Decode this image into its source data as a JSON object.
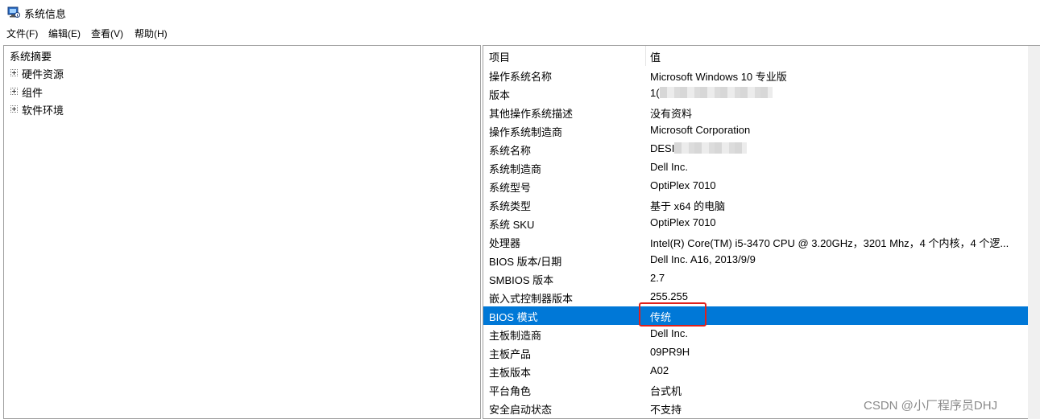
{
  "window": {
    "title": "系统信息",
    "icon": "system-information-icon"
  },
  "menu": [
    {
      "label": "文件(F)"
    },
    {
      "label": "编辑(E)"
    },
    {
      "label": "查看(V)"
    },
    {
      "label": "帮助(H)"
    }
  ],
  "tree": {
    "root": "系统摘要",
    "children": [
      {
        "label": "硬件资源"
      },
      {
        "label": "组件"
      },
      {
        "label": "软件环境"
      }
    ]
  },
  "table": {
    "headers": [
      "项目",
      "值"
    ],
    "rows": [
      {
        "k": "操作系统名称",
        "v": "Microsoft Windows 10 专业版"
      },
      {
        "k": "版本",
        "v": "1("
      },
      {
        "k": "其他操作系统描述",
        "v": "没有资料"
      },
      {
        "k": "操作系统制造商",
        "v": "Microsoft Corporation"
      },
      {
        "k": "系统名称",
        "v": "DESI"
      },
      {
        "k": "系统制造商",
        "v": "Dell Inc."
      },
      {
        "k": "系统型号",
        "v": "OptiPlex 7010"
      },
      {
        "k": "系统类型",
        "v": "基于 x64 的电脑"
      },
      {
        "k": "系统 SKU",
        "v": "OptiPlex 7010"
      },
      {
        "k": "处理器",
        "v": "Intel(R) Core(TM) i5-3470 CPU @ 3.20GHz，3201 Mhz，4 个内核，4 个逻..."
      },
      {
        "k": "BIOS 版本/日期",
        "v": "Dell Inc. A16, 2013/9/9"
      },
      {
        "k": "SMBIOS 版本",
        "v": "2.7"
      },
      {
        "k": "嵌入式控制器版本",
        "v": "255.255"
      },
      {
        "k": "BIOS 模式",
        "v": "传统"
      },
      {
        "k": "主板制造商",
        "v": "Dell Inc."
      },
      {
        "k": "主板产品",
        "v": "09PR9H"
      },
      {
        "k": "主板版本",
        "v": "A02"
      },
      {
        "k": "平台角色",
        "v": "台式机"
      },
      {
        "k": "安全启动状态",
        "v": "不支持"
      }
    ],
    "selected_index": 13
  },
  "watermark": "CSDN @小厂程序员DHJ",
  "colors": {
    "selection": "#0078d7",
    "annotation": "#e0201b"
  }
}
